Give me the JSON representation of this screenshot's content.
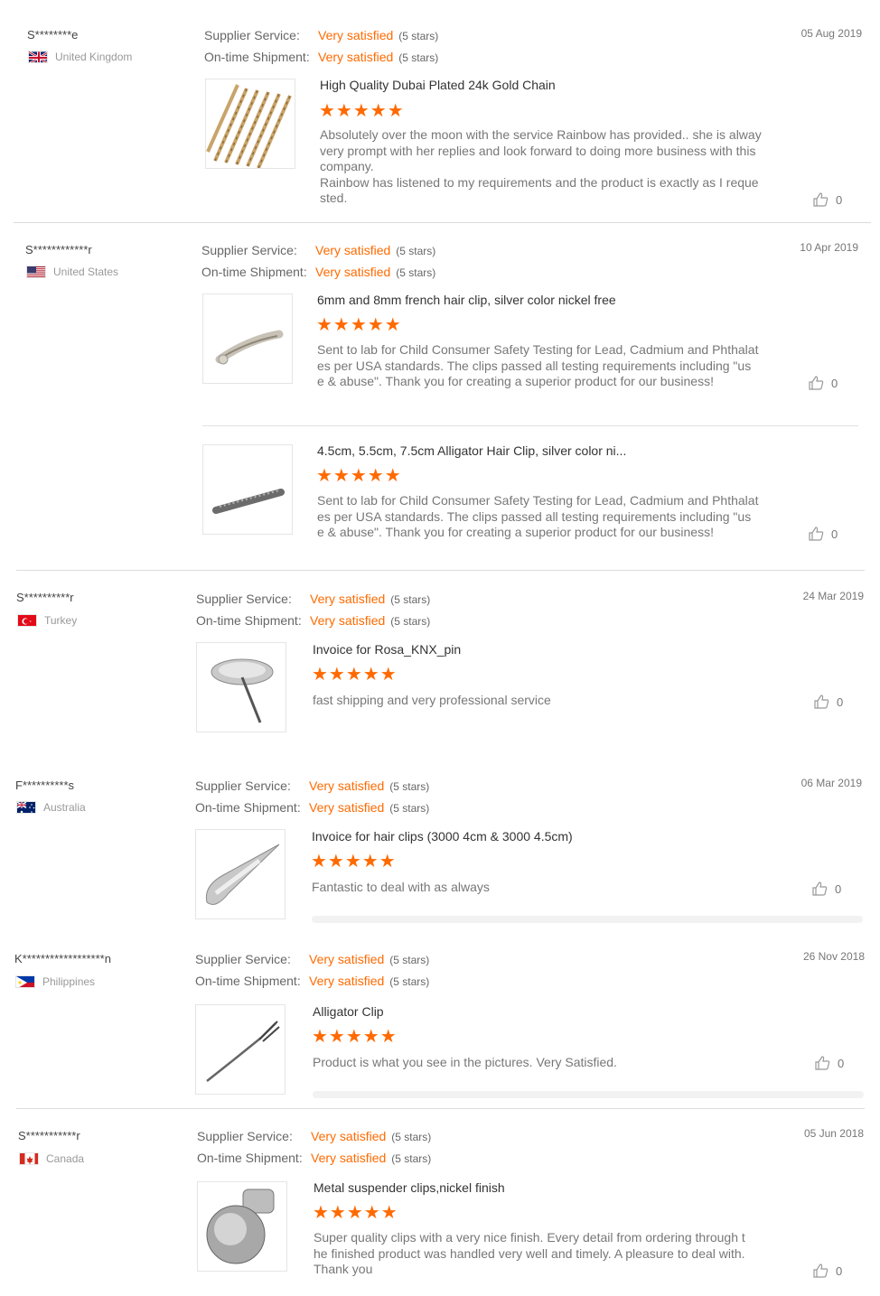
{
  "labels": {
    "supplier_service": "Supplier Service:",
    "ontime_shipment": "On-time Shipment:"
  },
  "colors": {
    "accent": "#ff6a00",
    "separator": "#dcdcdc"
  },
  "reviews": [
    {
      "buyer": "S********e",
      "country": "United Kingdom",
      "flag": "uk-flag",
      "supplier_service": "Very satisfied",
      "supplier_stars": "(5 stars)",
      "shipment": "Very satisfied",
      "shipment_stars": "(5 stars)",
      "date": "05 Aug 2019",
      "products": [
        {
          "name": "High Quality Dubai Plated 24k Gold Chain",
          "rating": 5,
          "stars": "★★★★★",
          "comment": "Absolutely over the moon with the service Rainbow has provided.. she is alway\nvery  prompt with her replies and look forward to doing more business with this\ncompany.\nRainbow has listened to my requirements and the product is exactly as I reque\nsted.",
          "likes": "0",
          "image": "gold-chain-image"
        }
      ]
    },
    {
      "buyer": "S************r",
      "country": "United States",
      "flag": "us-flag",
      "supplier_service": "Very satisfied",
      "supplier_stars": "(5 stars)",
      "shipment": "Very satisfied",
      "shipment_stars": "(5 stars)",
      "date": "10 Apr 2019",
      "products": [
        {
          "name": "6mm and 8mm french hair clip, silver color nickel free",
          "rating": 5,
          "stars": "★★★★★",
          "comment": "Sent to lab for Child Consumer Safety Testing for Lead, Cadmium and Phthalat\nes per USA standards.  The clips passed all testing requirements including \"us\ne & abuse\".   Thank you for creating a superior product for our business!",
          "likes": "0",
          "image": "french-hair-clip-image"
        },
        {
          "name": "4.5cm, 5.5cm, 7.5cm Alligator Hair Clip, silver color ni...",
          "rating": 5,
          "stars": "★★★★★",
          "comment": "Sent to lab for Child Consumer Safety Testing for Lead, Cadmium and Phthalat\nes per USA standards.  The clips passed all testing requirements including \"us\ne & abuse\".   Thank you for creating a superior product for our business!",
          "likes": "0",
          "image": "alligator-hair-clip-image"
        }
      ]
    },
    {
      "buyer": "S**********r",
      "country": "Turkey",
      "flag": "tr-flag",
      "supplier_service": "Very satisfied",
      "supplier_stars": "(5 stars)",
      "shipment": "Very satisfied",
      "shipment_stars": "(5 stars)",
      "date": "24 Mar 2019",
      "products": [
        {
          "name": "Invoice for Rosa_KNX_pin",
          "rating": 5,
          "stars": "★★★★★",
          "comment": "fast shipping and very professional service",
          "likes": "0",
          "image": "pin-image"
        }
      ]
    },
    {
      "buyer": "F**********s",
      "country": "Australia",
      "flag": "au-flag",
      "supplier_service": "Very satisfied",
      "supplier_stars": "(5 stars)",
      "shipment": "Very satisfied",
      "shipment_stars": "(5 stars)",
      "date": "06 Mar 2019",
      "products": [
        {
          "name": "Invoice for hair clips (3000 4cm & 3000 4.5cm)",
          "rating": 5,
          "stars": "★★★★★",
          "comment": "Fantastic to deal with as always",
          "likes": "0",
          "image": "snap-hair-clip-image"
        }
      ]
    },
    {
      "buyer": "K******************n",
      "country": "Philippines",
      "flag": "ph-flag",
      "supplier_service": "Very satisfied",
      "supplier_stars": "(5 stars)",
      "shipment": "Very satisfied",
      "shipment_stars": "(5 stars)",
      "date": "26 Nov 2018",
      "products": [
        {
          "name": "Alligator Clip",
          "rating": 5,
          "stars": "★★★★★",
          "comment": "Product is what you see in the pictures. Very Satisfied.",
          "likes": "0",
          "image": "alligator-clip-image"
        }
      ]
    },
    {
      "buyer": "S***********r",
      "country": "Canada",
      "flag": "ca-flag",
      "supplier_service": "Very satisfied",
      "supplier_stars": "(5 stars)",
      "shipment": "Very satisfied",
      "shipment_stars": "(5 stars)",
      "date": "05 Jun 2018",
      "products": [
        {
          "name": "Metal suspender clips,nickel finish",
          "rating": 5,
          "stars": "★★★★★",
          "comment": "Super quality clips with a very nice finish.  Every detail from ordering through t\nhe finished product was handled very well and timely.  A pleasure to deal with.\nThank you",
          "likes": "0",
          "image": "suspender-clip-image"
        }
      ]
    }
  ]
}
